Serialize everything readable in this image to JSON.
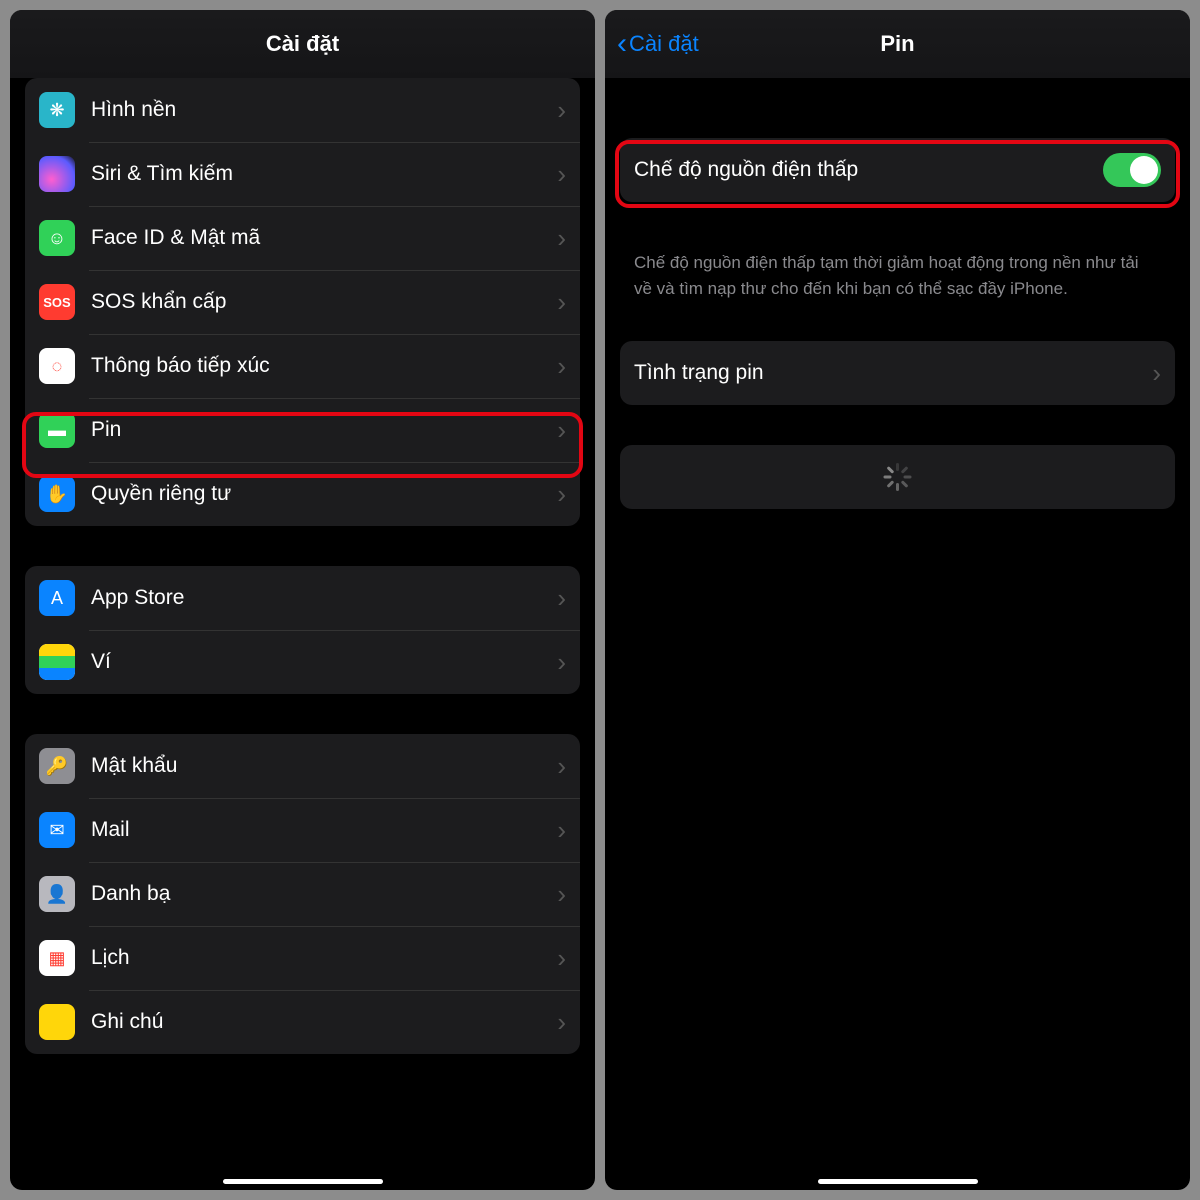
{
  "left": {
    "title": "Cài đặt",
    "groups": [
      {
        "items": [
          {
            "key": "wallpaper",
            "label": "Hình nền",
            "icon": "wallpaper-icon",
            "bg": "bg-wallpaper",
            "glyph": "❋"
          },
          {
            "key": "siri",
            "label": "Siri & Tìm kiếm",
            "icon": "siri-icon",
            "bg": "bg-siri",
            "glyph": ""
          },
          {
            "key": "faceid",
            "label": "Face ID & Mật mã",
            "icon": "faceid-icon",
            "bg": "bg-faceid",
            "glyph": "☺"
          },
          {
            "key": "sos",
            "label": "SOS khẩn cấp",
            "icon": "sos-icon",
            "bg": "bg-sos",
            "glyph": "SOS"
          },
          {
            "key": "exposure",
            "label": "Thông báo tiếp xúc",
            "icon": "exposure-icon",
            "bg": "bg-exposure",
            "glyph": "◌"
          },
          {
            "key": "battery",
            "label": "Pin",
            "icon": "battery-icon",
            "bg": "bg-battery",
            "glyph": "▬",
            "highlighted": true
          },
          {
            "key": "privacy",
            "label": "Quyền riêng tư",
            "icon": "privacy-icon",
            "bg": "bg-privacy",
            "glyph": "✋"
          }
        ]
      },
      {
        "items": [
          {
            "key": "appstore",
            "label": "App Store",
            "icon": "appstore-icon",
            "bg": "bg-appstore",
            "glyph": "A"
          },
          {
            "key": "wallet",
            "label": "Ví",
            "icon": "wallet-icon",
            "bg": "bg-wallet",
            "glyph": ""
          }
        ]
      },
      {
        "items": [
          {
            "key": "passwords",
            "label": "Mật khẩu",
            "icon": "passwords-icon",
            "bg": "bg-passwords",
            "glyph": "🔑"
          },
          {
            "key": "mail",
            "label": "Mail",
            "icon": "mail-icon",
            "bg": "bg-mail",
            "glyph": "✉"
          },
          {
            "key": "contacts",
            "label": "Danh bạ",
            "icon": "contacts-icon",
            "bg": "bg-contacts",
            "glyph": "👤"
          },
          {
            "key": "calendar",
            "label": "Lịch",
            "icon": "calendar-icon",
            "bg": "bg-calendar",
            "glyph": "▦"
          },
          {
            "key": "notes",
            "label": "Ghi chú",
            "icon": "notes-icon",
            "bg": "bg-notes",
            "glyph": ""
          }
        ]
      }
    ]
  },
  "right": {
    "back_label": "Cài đặt",
    "title": "Pin",
    "low_power": {
      "label": "Chế độ nguồn điện thấp",
      "on": true
    },
    "low_power_footer": "Chế độ nguồn điện thấp tạm thời giảm hoạt động trong nền như tải về và tìm nạp thư cho đến khi bạn có thể sạc đầy iPhone.",
    "battery_health": {
      "label": "Tình trạng pin"
    }
  }
}
